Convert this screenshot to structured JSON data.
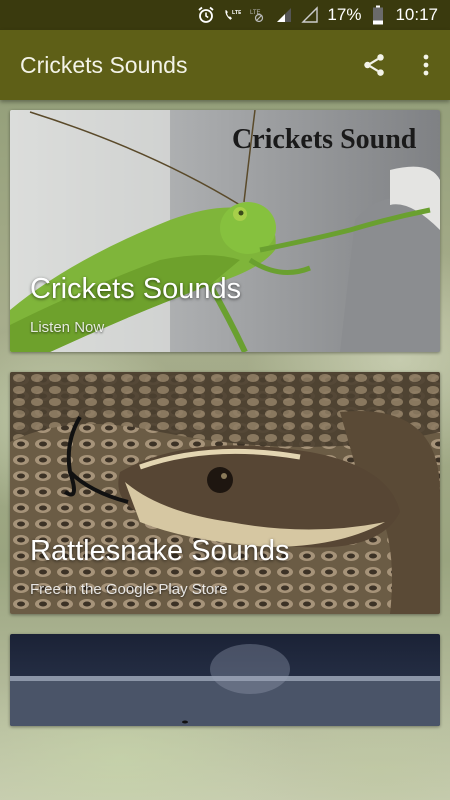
{
  "status_bar": {
    "icons": [
      "alarm-icon",
      "phone-lte-icon",
      "data-icon",
      "signal-icon",
      "signal-empty-icon",
      "battery-icon"
    ],
    "battery_percent": "17%",
    "time": "10:17"
  },
  "app_bar": {
    "title": "Crickets Sounds",
    "actions": [
      "share-icon",
      "overflow-menu-icon"
    ]
  },
  "cards": [
    {
      "image_text": "Crickets Sound",
      "title": "Crickets Sounds",
      "subtitle": "Listen Now"
    },
    {
      "title": "Rattlesnake Sounds",
      "subtitle": "Free in the Google Play Store"
    },
    {
      "title": "",
      "subtitle": ""
    }
  ],
  "colors": {
    "status_bar": "#3a3a0e",
    "app_bar": "#5e5f17"
  }
}
